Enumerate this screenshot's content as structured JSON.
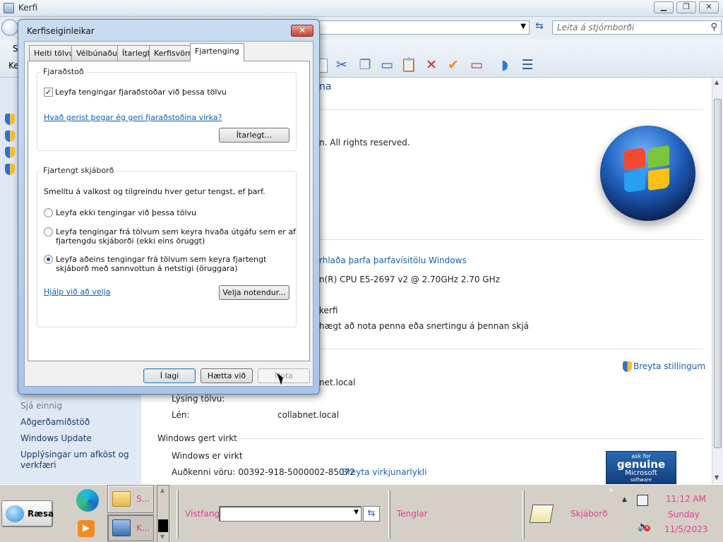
{
  "window": {
    "title": "Kerfi",
    "minimize": "▁",
    "maximize": "❐",
    "close": "✕",
    "search_placeholder": "Leita á stjórnborði",
    "toolbar_stub_1": "S",
    "toolbar_stub_2": "Ke"
  },
  "content": {
    "heading_fragment": "na",
    "copyright_fragment": "n.  All rights reserved.",
    "rating_link": "rhlaða þarfa þarfavísitölu Windows",
    "processor_fragment": "n(R) CPU E5-2697 v2 @ 2.70GHz   2.70 GHz",
    "system_type_fragment": "kerfi",
    "pen_fragment": "hægt að nota penna eða snertingu á þennan skjá",
    "change_settings": "Breyta stillingum",
    "domain_fragment": "net.local",
    "description_label": "Lýsing tölvu:",
    "domain_label": "Lén:",
    "domain_value": "collabnet.local",
    "activation_heading": "Windows gert virkt",
    "activation_status": "Windows er virkt",
    "product_id": "Auðkenni vöru: 00392-918-5000002-85072",
    "change_key": "Breyta virkjunarlykli",
    "genuine_badge": {
      "line1": "ask for",
      "line2": "genuine",
      "line3": "Microsoft",
      "line4": "software"
    }
  },
  "left_nav": {
    "see_also": "Sjá einnig",
    "items": [
      "Aðgerðamiðstöð",
      "Windows Update",
      "Upplýsingar um afköst og verkfæri"
    ]
  },
  "dialog": {
    "title": "Kerfiseiginleikar",
    "close": "✕",
    "tabs": [
      "Heiti tölvu",
      "Vélbúnaður",
      "Ítarlegt",
      "Kerfisvörn",
      "Fjartenging"
    ],
    "remote_assistance": {
      "legend": "Fjaraðstoð",
      "checkbox_label": "Leyfa tengingar fjaraðstoðar við þessa tölvu",
      "checked": true,
      "help_link": "Hvað gerist þegar ég geri fjaraðstoðina virka?",
      "advanced_button": "Ítarlegt..."
    },
    "remote_desktop": {
      "legend": "Fjartengt skjáborð",
      "instruction": "Smelltu á valkost og tilgreindu hver getur tengst, ef þarf.",
      "options": [
        "Leyfa ekki tengingar við þessa tölvu",
        "Leyfa tengingar frá tölvum sem keyra hvaða útgáfu sem er af fjartengdu skjáborði (ekki eins öruggt)",
        "Leyfa aðeins tengingar frá tölvum sem keyra fjartengt skjáborð með sannvottun á netstigi (öruggara)"
      ],
      "selected_index": 2,
      "help_link": "Hjálp við að velja",
      "select_users_button": "Velja notendur..."
    },
    "ok": "Í lagi",
    "cancel": "Hætta við",
    "apply": "Nota"
  },
  "taskbar": {
    "start": "Ræsa",
    "task1": "S...",
    "task2": "K...",
    "address_label": "Vistfang",
    "links_label": "Tenglar",
    "desktop_label": "Skjáborð",
    "time": "11:12 AM",
    "day": "Sunday",
    "date": "11/5/2023",
    "chevron": "»"
  },
  "colors": {
    "accent_link": "#1e5fa8",
    "taskbar_text": "#e0408f",
    "dialog_frame": "#a9c4e6"
  }
}
